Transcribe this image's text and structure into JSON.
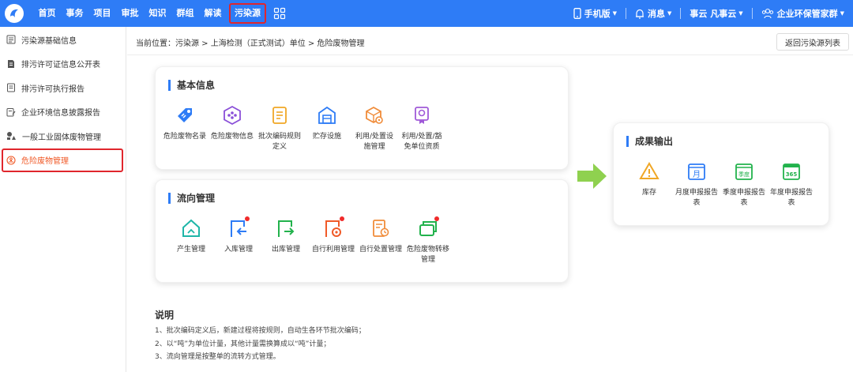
{
  "topnav": {
    "items": [
      "首页",
      "事务",
      "项目",
      "审批",
      "知识",
      "群组",
      "解读",
      "污染源"
    ],
    "active_index": 7,
    "right": {
      "mobile": "手机版",
      "messages": "消息",
      "user": "事云  凡事云",
      "org": "企业环保管家群"
    }
  },
  "sidebar": {
    "items": [
      {
        "label": "污染源基础信息",
        "icon": "info-doc-icon"
      },
      {
        "label": "排污许可证信息公开表",
        "icon": "license-doc-icon"
      },
      {
        "label": "排污许可执行报告",
        "icon": "report-doc-icon"
      },
      {
        "label": "企业环境信息披露报告",
        "icon": "edit-doc-icon"
      },
      {
        "label": "一般工业固体废物管理",
        "icon": "shapes-icon"
      },
      {
        "label": "危险废物管理",
        "icon": "hazard-icon",
        "active": true
      }
    ]
  },
  "breadcrumb": "当前位置：污染源 > 上海检测（正式测试）单位 > 危险废物管理",
  "back_button": "返回污染源列表",
  "basic_info": {
    "title": "基本信息",
    "items": [
      {
        "label": "危险废物名录",
        "icon": "tag-icon"
      },
      {
        "label": "危险废物信息",
        "icon": "hexagon-info-icon"
      },
      {
        "label": "批次编码规则定义",
        "icon": "doc-rules-icon"
      },
      {
        "label": "贮存设施",
        "icon": "warehouse-icon"
      },
      {
        "label": "利用/处置设施管理",
        "icon": "box-gear-icon"
      },
      {
        "label": "利用/处置/豁免单位资质",
        "icon": "certificate-icon"
      }
    ]
  },
  "flow": {
    "title": "流向管理",
    "items": [
      {
        "label": "产生管理",
        "icon": "house-generate-icon",
        "dot": false
      },
      {
        "label": "入库管理",
        "icon": "inbound-icon",
        "dot": true
      },
      {
        "label": "出库管理",
        "icon": "outbound-icon",
        "dot": false
      },
      {
        "label": "自行利用管理",
        "icon": "self-use-icon",
        "dot": true
      },
      {
        "label": "自行处置管理",
        "icon": "self-dispose-icon",
        "dot": false
      },
      {
        "label": "危险废物转移管理",
        "icon": "transfer-icon",
        "dot": true
      }
    ]
  },
  "output": {
    "title": "成果输出",
    "items": [
      {
        "label": "库存",
        "icon": "warning-triangle-icon"
      },
      {
        "label": "月度申报报告表",
        "icon": "calendar-month-icon",
        "glyph": "月"
      },
      {
        "label": "季度申报报告表",
        "icon": "calendar-quarter-icon",
        "glyph": "季度"
      },
      {
        "label": "年度申报报告表",
        "icon": "calendar-year-icon",
        "glyph": "365"
      }
    ]
  },
  "notes": {
    "title": "说明",
    "lines": [
      "1、批次编码定义后，新建过程将按规则，自动生各环节批次编码；",
      "2、以“吨”为单位计量，其他计量需换算成以“吨”计量；",
      "3、流向管理是按整单的流转方式管理。"
    ]
  },
  "colors": {
    "primary": "#2e7cf6",
    "active": "#f05a28",
    "highlight_border": "#e0262d",
    "badge": "#f02b2b"
  }
}
